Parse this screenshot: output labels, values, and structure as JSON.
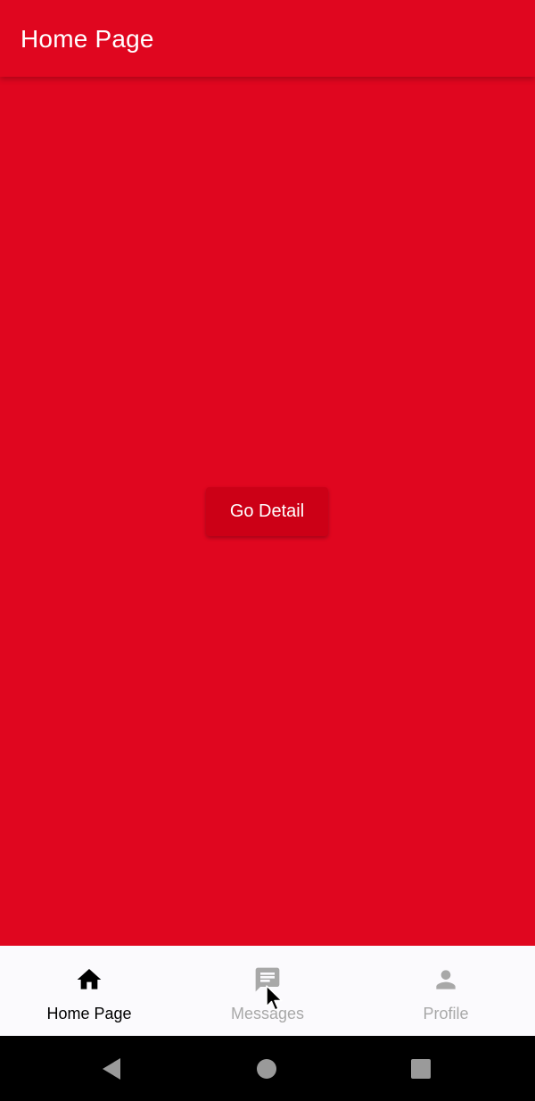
{
  "appbar": {
    "title": "Home Page"
  },
  "main": {
    "button_label": "Go Detail"
  },
  "bottom_nav": {
    "items": [
      {
        "label": "Home Page",
        "icon": "home-icon",
        "active": true
      },
      {
        "label": "Messages",
        "icon": "message-icon",
        "active": false
      },
      {
        "label": "Profile",
        "icon": "person-icon",
        "active": false
      }
    ]
  },
  "system_nav": {
    "buttons": [
      "back-icon",
      "home-circle-icon",
      "recents-icon"
    ]
  },
  "colors": {
    "primary": "#e0061f",
    "button": "#cc0016",
    "nav_background": "#fbfafd",
    "active": "#000000",
    "inactive": "#a8a8a8"
  }
}
